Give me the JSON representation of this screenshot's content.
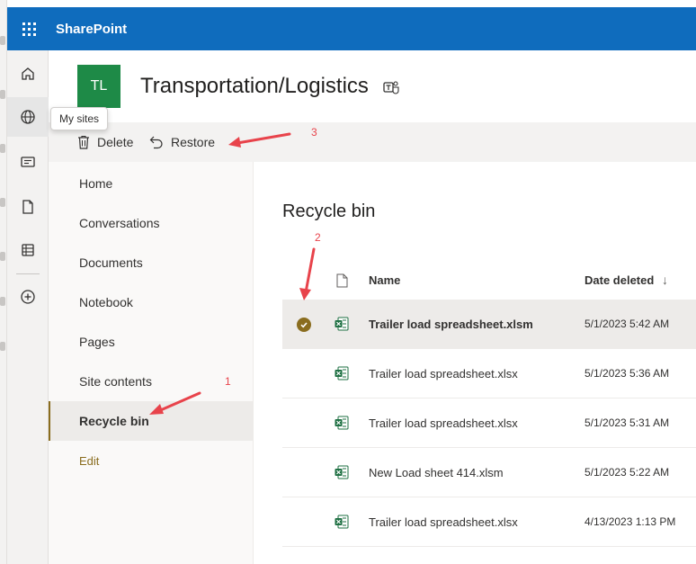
{
  "suite": {
    "app_name": "SharePoint"
  },
  "appbar": {
    "tooltip": "My sites"
  },
  "site": {
    "logo_initials": "TL",
    "title": "Transportation/Logistics"
  },
  "commands": {
    "delete_label": "Delete",
    "restore_label": "Restore"
  },
  "nav": {
    "items": [
      {
        "label": "Home"
      },
      {
        "label": "Conversations"
      },
      {
        "label": "Documents"
      },
      {
        "label": "Notebook"
      },
      {
        "label": "Pages"
      },
      {
        "label": "Site contents"
      },
      {
        "label": "Recycle bin"
      }
    ],
    "edit_label": "Edit"
  },
  "content": {
    "title": "Recycle bin",
    "columns": {
      "name": "Name",
      "date_deleted": "Date deleted",
      "sort": "↓"
    },
    "rows": [
      {
        "name": "Trailer load spreadsheet.xlsm",
        "date": "5/1/2023 5:42 AM",
        "selected": true
      },
      {
        "name": "Trailer load spreadsheet.xlsx",
        "date": "5/1/2023 5:36 AM",
        "selected": false
      },
      {
        "name": "Trailer load spreadsheet.xlsx",
        "date": "5/1/2023 5:31 AM",
        "selected": false
      },
      {
        "name": "New Load sheet 414.xlsm",
        "date": "5/1/2023 5:22 AM",
        "selected": false
      },
      {
        "name": "Trailer load spreadsheet.xlsx",
        "date": "4/13/2023 1:13 PM",
        "selected": false
      }
    ]
  },
  "annotations": {
    "n1": "1",
    "n2": "2",
    "n3": "3",
    "color": "#e8434b"
  },
  "colors": {
    "suitebar": "#0f6cbd",
    "site_logo": "#1e8a47",
    "accent": "#8a6d1f",
    "excel": "#1d6f42"
  }
}
